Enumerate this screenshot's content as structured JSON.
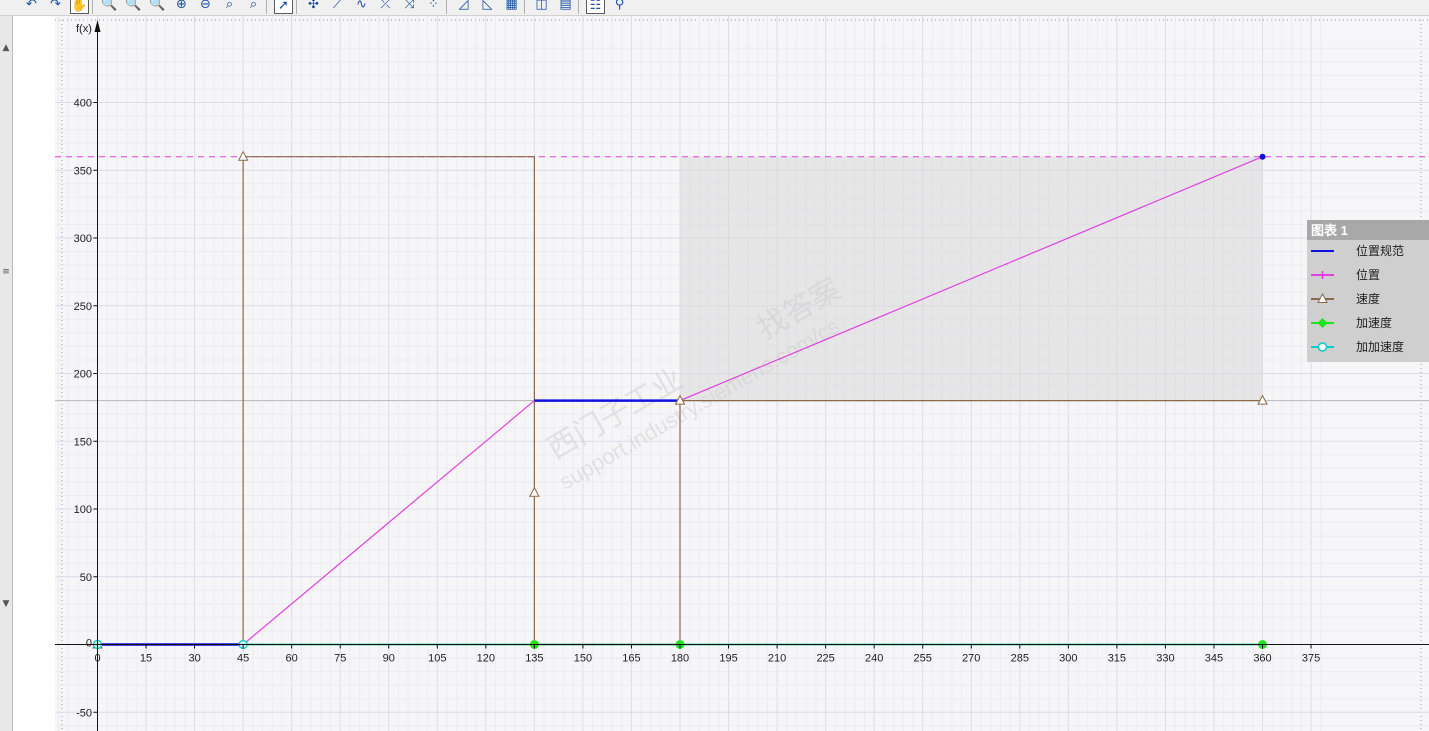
{
  "colors": {
    "position_spec": "#1010e0",
    "position": "#e040e0",
    "velocity": "#8b6a4a",
    "acceleration": "#22e022",
    "jerk": "#11c8c8",
    "legend_title_bg": "#a8a8a8",
    "legend_bg": "#cfcfcf"
  },
  "toolbar": {
    "buttons": [
      {
        "name": "undo-icon",
        "glyph": "↶"
      },
      {
        "name": "redo-icon",
        "glyph": "↷"
      },
      {
        "name": "pan-hand-icon",
        "glyph": "✋"
      },
      {
        "name": "zoom-window-icon",
        "glyph": "🔍"
      },
      {
        "name": "zoom-horizontal-icon",
        "glyph": "🔍"
      },
      {
        "name": "zoom-vertical-icon",
        "glyph": "🔍"
      },
      {
        "name": "zoom-in-icon",
        "glyph": "⊕"
      },
      {
        "name": "zoom-out-icon",
        "glyph": "⊖"
      },
      {
        "name": "zoom-fit-icon",
        "glyph": "⌕"
      },
      {
        "name": "zoom-reset-icon",
        "glyph": "⌕"
      },
      {
        "name": "select-pointer-icon",
        "glyph": "➚"
      },
      {
        "name": "insert-point-icon",
        "glyph": "✣"
      },
      {
        "name": "insert-line-icon",
        "glyph": "⟋"
      },
      {
        "name": "insert-curve-icon",
        "glyph": "∿"
      },
      {
        "name": "insert-segment-icon",
        "glyph": "⤫"
      },
      {
        "name": "insert-spline-icon",
        "glyph": "⤨"
      },
      {
        "name": "insert-poly-icon",
        "glyph": "⁘"
      },
      {
        "name": "chart-view-icon",
        "glyph": "◿"
      },
      {
        "name": "chart-area-icon",
        "glyph": "◺"
      },
      {
        "name": "chart-table-icon",
        "glyph": "▦"
      },
      {
        "name": "column-icon",
        "glyph": "◫"
      },
      {
        "name": "row-icon",
        "glyph": "▤"
      },
      {
        "name": "legend-toggle-icon",
        "glyph": "☷"
      },
      {
        "name": "search-icon",
        "glyph": "⚲"
      }
    ]
  },
  "chart_data": {
    "type": "line",
    "ylabel": "f(x)",
    "xlim": [
      0,
      375
    ],
    "ylim": [
      -50,
      400
    ],
    "x_ticks": [
      0,
      15,
      30,
      45,
      60,
      75,
      90,
      105,
      120,
      135,
      150,
      165,
      180,
      195,
      210,
      225,
      240,
      255,
      270,
      285,
      300,
      315,
      330,
      345,
      360,
      375
    ],
    "y_ticks": [
      400,
      350,
      300,
      250,
      200,
      150,
      100,
      50,
      0,
      -50
    ],
    "x_tick_labels": [
      "0",
      "15",
      "30",
      "45",
      "60",
      "75",
      "90",
      "105",
      "120",
      "135",
      "150",
      "165",
      "180",
      "195",
      "210",
      "225",
      "240",
      "255",
      "270",
      "285",
      "300",
      "315",
      "330",
      "345",
      "360",
      "375"
    ],
    "y_tick_labels": [
      "400",
      "350",
      "300",
      "250",
      "200",
      "150",
      "100",
      "50",
      "0",
      "-50"
    ],
    "grid": true,
    "legend": {
      "title": "图表 1",
      "placement": "right",
      "entries": [
        "位置规范",
        "位置",
        "速度",
        "加速度",
        "加加速度"
      ]
    },
    "reference_lines": [
      {
        "axis": "y",
        "value": 360,
        "color": "#e040e0",
        "style": "dashed"
      },
      {
        "axis": "y",
        "value": 180,
        "color": "#b8b8b8",
        "style": "solid"
      }
    ],
    "highlight_region": {
      "x": [
        180,
        360
      ],
      "y": [
        180,
        360
      ]
    },
    "series": [
      {
        "name": "位置规范",
        "key": "position_spec",
        "marker": "none",
        "segments": [
          [
            [
              0,
              0
            ],
            [
              45,
              0
            ]
          ],
          [
            [
              135,
              180
            ],
            [
              180,
              180
            ]
          ]
        ]
      },
      {
        "name": "位置",
        "key": "position",
        "marker": "none",
        "points": [
          [
            0,
            0
          ],
          [
            45,
            0
          ],
          [
            135,
            180
          ],
          [
            180,
            180
          ],
          [
            360,
            360
          ]
        ]
      },
      {
        "name": "速度",
        "key": "velocity",
        "marker": "triangle",
        "points": [
          [
            0,
            0
          ],
          [
            45,
            0
          ],
          [
            45,
            360
          ],
          [
            135,
            360
          ],
          [
            135,
            0
          ],
          [
            180,
            0
          ],
          [
            180,
            180
          ],
          [
            360,
            180
          ]
        ],
        "marker_points": [
          [
            0,
            0
          ],
          [
            45,
            360
          ],
          [
            135,
            112
          ],
          [
            180,
            180
          ],
          [
            360,
            180
          ]
        ]
      },
      {
        "name": "加速度",
        "key": "acceleration",
        "marker": "diamond",
        "points": [
          [
            0,
            0
          ],
          [
            360,
            0
          ]
        ],
        "marker_points": [
          [
            0,
            0
          ],
          [
            45,
            0
          ],
          [
            135,
            0
          ],
          [
            180,
            0
          ],
          [
            360,
            0
          ]
        ]
      },
      {
        "name": "加加速度",
        "key": "jerk",
        "marker": "circle",
        "points": [
          [
            0,
            0
          ],
          [
            360,
            0
          ]
        ],
        "marker_points": [
          [
            0,
            0
          ],
          [
            45,
            0
          ]
        ]
      }
    ],
    "end_point_marker": {
      "x": 360,
      "y": 360
    }
  },
  "watermark": {
    "lines": [
      "找答案",
      "support.industry.siemens.com/cs",
      "西门子工业"
    ]
  }
}
